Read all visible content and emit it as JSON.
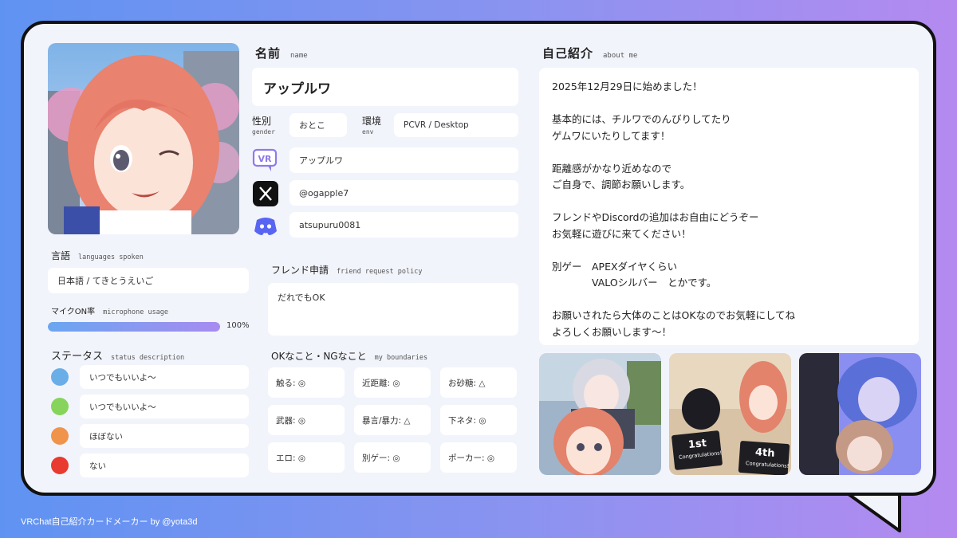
{
  "name": {
    "title": "名前",
    "sub": "name",
    "value": "アップルワ"
  },
  "gender": {
    "title": "性別",
    "sub": "gender",
    "value": "おとこ"
  },
  "env": {
    "title": "環境",
    "sub": "env",
    "value": "PCVR / Desktop"
  },
  "accounts": {
    "vrchat": "アップルワ",
    "x": "@ogapple7",
    "discord": "atsupuru0081"
  },
  "languages": {
    "title": "言語",
    "sub": "languages spoken",
    "value": "日本語 / てきとうえいご"
  },
  "mic": {
    "title": "マイクON率",
    "sub": "microphone usage",
    "percent": 100,
    "percent_label": "100%"
  },
  "status": {
    "title": "ステータス",
    "sub": "status description",
    "items": [
      {
        "color": "#6aaee8",
        "text": "いつでもいいよ～"
      },
      {
        "color": "#86d45c",
        "text": "いつでもいいよ～"
      },
      {
        "color": "#f0944c",
        "text": "ほぼない"
      },
      {
        "color": "#e83a2e",
        "text": "ない"
      }
    ]
  },
  "friend_request": {
    "title": "フレンド申請",
    "sub": "friend request policy",
    "value": "だれでもOK"
  },
  "boundaries": {
    "title": "OKなこと・NGなこと",
    "sub": "my boundaries",
    "items": [
      "触る: ◎",
      "近距離: ◎",
      "お砂糖: △",
      "武器: ◎",
      "暴言/暴力: △",
      "下ネタ: ◎",
      "エロ: ◎",
      "別ゲー: ◎",
      "ポーカー: ◎"
    ]
  },
  "about": {
    "title": "自己紹介",
    "sub": "about me",
    "text": "2025年12月29日に始めました！\n\n基本的には、チルワでのんびりしてたり\nゲムワにいたりしてます！\n\n距離感がかなり近めなので\nご自身で、調節お願いします。\n\nフレンドやDiscordの追加はお自由にどうぞー\nお気軽に遊びに来てください！\n\n別ゲー　APEXダイヤくらい\n　　　　VALOシルバー　とかです。\n\nお願いされたら大体のことはOKなのでお気軽にしてね\nよろしくお願いします～！"
  },
  "photos": {
    "p2_rank1": "1st",
    "p2_rank1_sub": "Congratulations!",
    "p2_rank2": "4th",
    "p2_rank2_sub": "Congratulations!"
  },
  "footer": "VRChat自己紹介カードメーカー by @yota3d",
  "colors": {
    "accent_bar_start": "#6aa6f0",
    "accent_bar_end": "#a78bf0",
    "discord": "#5865f2",
    "vrchat": "#8f7ae8"
  }
}
